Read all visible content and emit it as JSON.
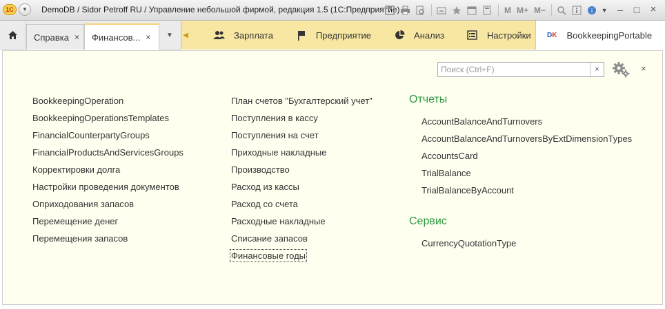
{
  "window": {
    "title": "DemoDB / Sidor Petroff RU / Управление небольшой фирмой, редакция 1.5  (1С:Предприятие)",
    "logo_text": "1С",
    "toolbar_text": {
      "m": "M",
      "mplus": "M+",
      "mminus": "M−"
    }
  },
  "tabs": [
    {
      "label": "Справка",
      "close": "×"
    },
    {
      "label": "Финансов...",
      "close": "×"
    }
  ],
  "sections": [
    {
      "label": "Зарплата",
      "icon": "users-icon"
    },
    {
      "label": "Предприятие",
      "icon": "flag-icon"
    },
    {
      "label": "Анализ",
      "icon": "pie-chart-icon"
    },
    {
      "label": "Настройки",
      "icon": "settings-list-icon"
    }
  ],
  "extension": {
    "badge_d": "D",
    "badge_k": "K",
    "label": "BookkeepingPortable"
  },
  "search": {
    "placeholder": "Поиск (Ctrl+F)",
    "value": "",
    "clear": "×"
  },
  "panel": {
    "close": "×"
  },
  "column1": [
    "BookkeepingOperation",
    "BookkeepingOperationsTemplates",
    "FinancialCounterpartyGroups",
    "FinancialProductsAndServicesGroups",
    "Корректировки долга",
    "Настройки проведения документов",
    "Оприходования запасов",
    "Перемещение денег",
    "Перемещения запасов"
  ],
  "column2": [
    "План счетов \"Бухгалтерский учет\"",
    "Поступления в кассу",
    "Поступления на счет",
    "Приходные накладные",
    "Производство",
    "Расход из кассы",
    "Расход со счета",
    "Расходные накладные",
    "Списание запасов",
    "Финансовые годы"
  ],
  "reports": {
    "title": "Отчеты",
    "items": [
      "AccountBalanceAndTurnovers",
      "AccountBalanceAndTurnoversByExtDimensionTypes",
      "AccountsCard",
      "TrialBalance",
      "TrialBalanceByAccount"
    ]
  },
  "service": {
    "title": "Сервис",
    "items": [
      "CurrencyQuotationType"
    ]
  },
  "colors": {
    "group_title": "#2b9740",
    "section_bar": "#f7e7a3",
    "content_bg": "#fffff0"
  }
}
